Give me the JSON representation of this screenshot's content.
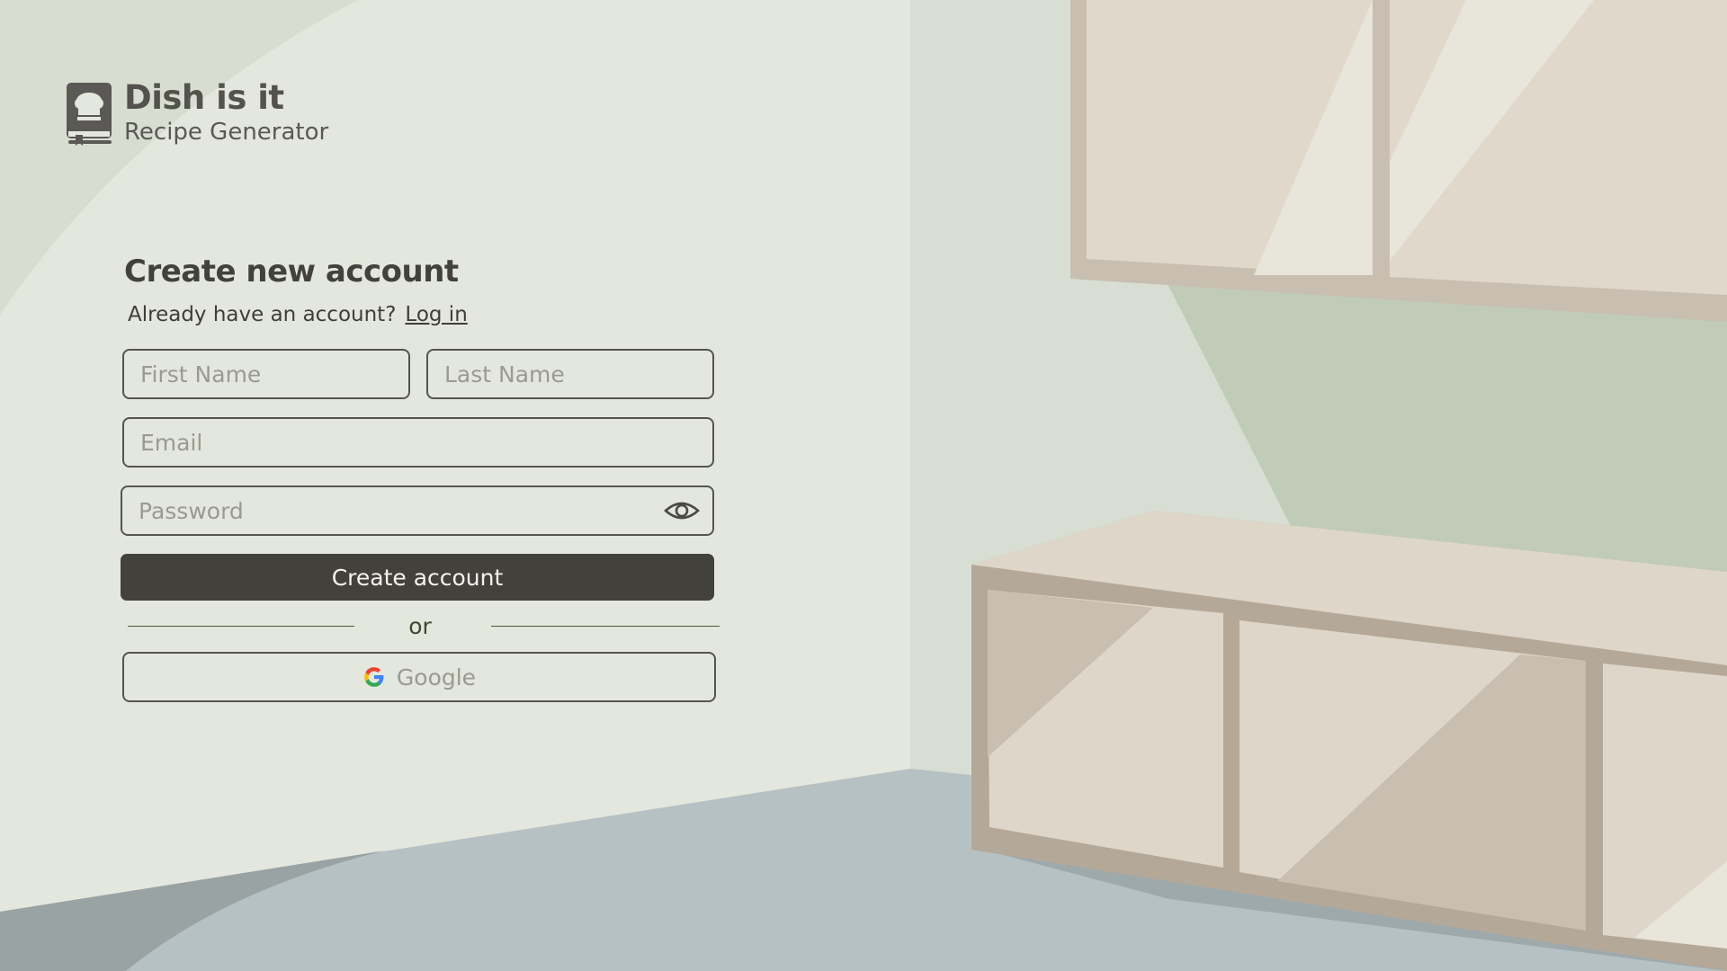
{
  "brand": {
    "name": "Dish is it",
    "subtitle": "Recipe Generator",
    "icon": "chef-hat-book-icon"
  },
  "form": {
    "heading": "Create new account",
    "already_text": "Already have an account?",
    "login_link": "Log in",
    "first_name_placeholder": "First Name",
    "last_name_placeholder": "Last Name",
    "email_placeholder": "Email",
    "password_placeholder": "Password",
    "password_toggle_icon": "eye-icon",
    "create_button": "Create account",
    "divider_text": "or",
    "google_button": "Google",
    "google_icon": "google-icon"
  },
  "colors": {
    "primary_button": "#43413c",
    "text_dark": "#43413d",
    "background_left": "#e4e7dd",
    "cabinet": "#ded7c9",
    "floor": "#b6c1c4",
    "shadow_green": "#c1ccb8"
  }
}
